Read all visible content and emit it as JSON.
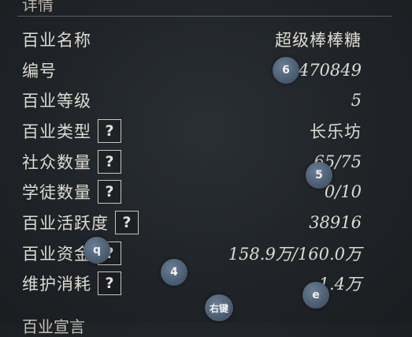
{
  "header": {
    "title": "详情"
  },
  "rows": [
    {
      "label": "百业名称",
      "value": "超级棒棒糖",
      "help": false
    },
    {
      "label": "编号",
      "value": "470849",
      "help": false
    },
    {
      "label": "百业等级",
      "value": "5",
      "help": false
    },
    {
      "label": "百业类型",
      "value": "长乐坊",
      "help": true
    },
    {
      "label": "社众数量",
      "value": "65/75",
      "help": true
    },
    {
      "label": "学徒数量",
      "value": "0/10",
      "help": true
    },
    {
      "label": "百业活跃度",
      "value": "38916",
      "help": true
    },
    {
      "label": "百业资金",
      "value": "158.9万/160.0万",
      "help": true
    },
    {
      "label": "维护消耗",
      "value": "1.4万",
      "help": true
    }
  ],
  "help_glyph": "?",
  "cut_off_row": {
    "label": "百业宣言"
  },
  "key_hints": {
    "hint_6": "6",
    "hint_5": "5",
    "hint_q": "q",
    "hint_4": "4",
    "hint_e": "e",
    "hint_right_click": "右键"
  }
}
